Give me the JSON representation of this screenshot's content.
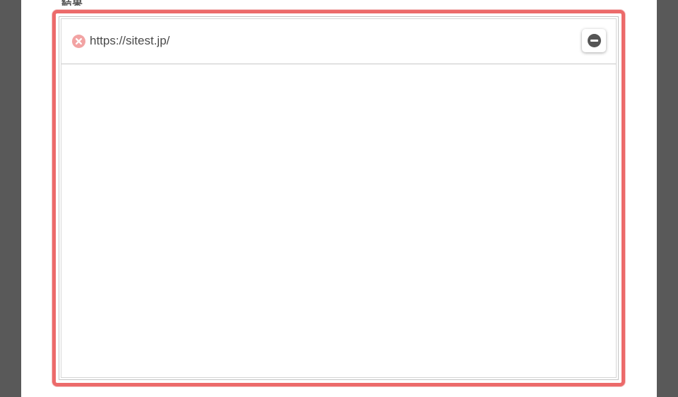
{
  "section": {
    "title": "結果"
  },
  "result": {
    "url": "https://sitest.jp/",
    "status_icon": "error-circle-icon",
    "remove_icon": "minus-circle-icon",
    "colors": {
      "frame": "#ec6a6a",
      "status": "#f2a3a3",
      "remove": "#555555"
    }
  }
}
